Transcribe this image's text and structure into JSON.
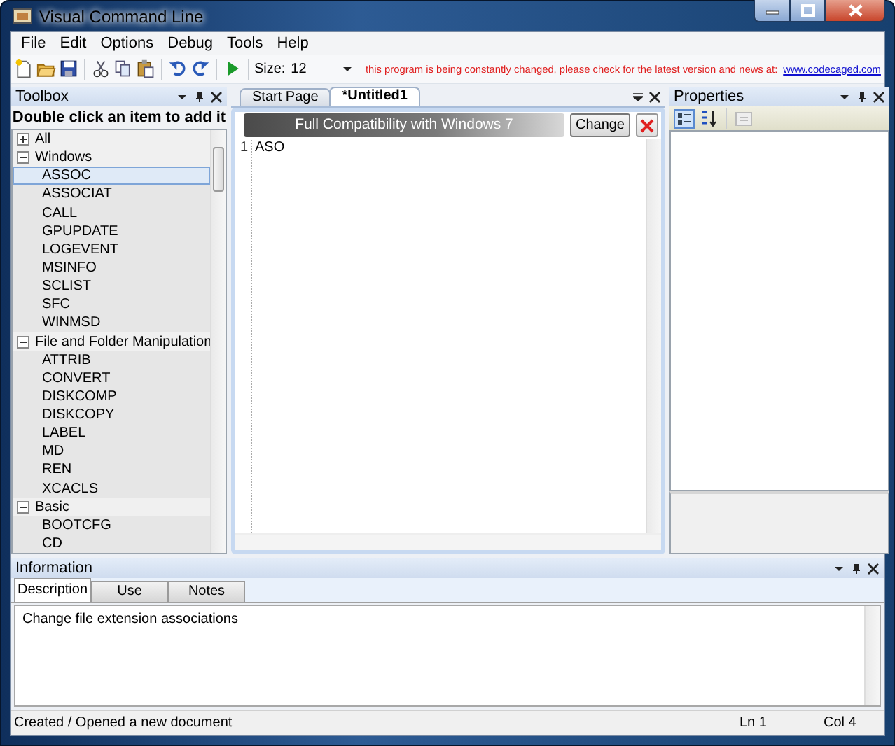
{
  "window": {
    "title": "Visual Command Line"
  },
  "menu": [
    "File",
    "Edit",
    "Options",
    "Debug",
    "Tools",
    "Help"
  ],
  "toolbar": {
    "size_label": "Size:",
    "size_value": "12",
    "notice": "this program is being constantly changed, please check for the latest version and news at:",
    "link": "www.codecaged.com"
  },
  "toolbox": {
    "title": "Toolbox",
    "hint": "Double click an item to add it",
    "groups": [
      {
        "label": "All",
        "expanded": false
      },
      {
        "label": "Windows",
        "expanded": true,
        "items": [
          {
            "label": "ASSOC",
            "selected": true
          },
          {
            "label": "ASSOCIAT",
            "selected": false
          },
          {
            "label": "CALL",
            "selected": false
          },
          {
            "label": "GPUPDATE",
            "selected": false
          },
          {
            "label": "LOGEVENT",
            "selected": false
          },
          {
            "label": "MSINFO",
            "selected": false
          },
          {
            "label": "SCLIST",
            "selected": false
          },
          {
            "label": "SFC",
            "selected": false
          },
          {
            "label": "WINMSD",
            "selected": false
          }
        ]
      },
      {
        "label": "File and Folder Manipulation",
        "expanded": true,
        "items": [
          {
            "label": "ATTRIB",
            "selected": false
          },
          {
            "label": "CONVERT",
            "selected": false
          },
          {
            "label": "DISKCOMP",
            "selected": false
          },
          {
            "label": "DISKCOPY",
            "selected": false
          },
          {
            "label": "LABEL",
            "selected": false
          },
          {
            "label": "MD",
            "selected": false
          },
          {
            "label": "REN",
            "selected": false
          },
          {
            "label": "XCACLS",
            "selected": false
          }
        ]
      },
      {
        "label": "Basic",
        "expanded": true,
        "items": [
          {
            "label": "BOOTCFG",
            "selected": false
          },
          {
            "label": "CD",
            "selected": false
          }
        ]
      }
    ]
  },
  "document": {
    "tabs": [
      {
        "label": "Start Page",
        "selected": false
      },
      {
        "label": "*Untitled1",
        "selected": true
      }
    ],
    "banner": {
      "text": "Full Compatibility with Windows 7",
      "button": "Change"
    },
    "lines": [
      {
        "number": "1",
        "text": "ASO"
      }
    ]
  },
  "properties": {
    "title": "Properties"
  },
  "information": {
    "title": "Information",
    "tabs": [
      {
        "label": "Description",
        "selected": true
      },
      {
        "label": "Use",
        "selected": false
      },
      {
        "label": "Notes",
        "selected": false
      }
    ],
    "text": "Change file extension associations"
  },
  "status_bar": {
    "message": "Created / Opened a new document",
    "line": "Ln 1",
    "column": "Col 4"
  }
}
